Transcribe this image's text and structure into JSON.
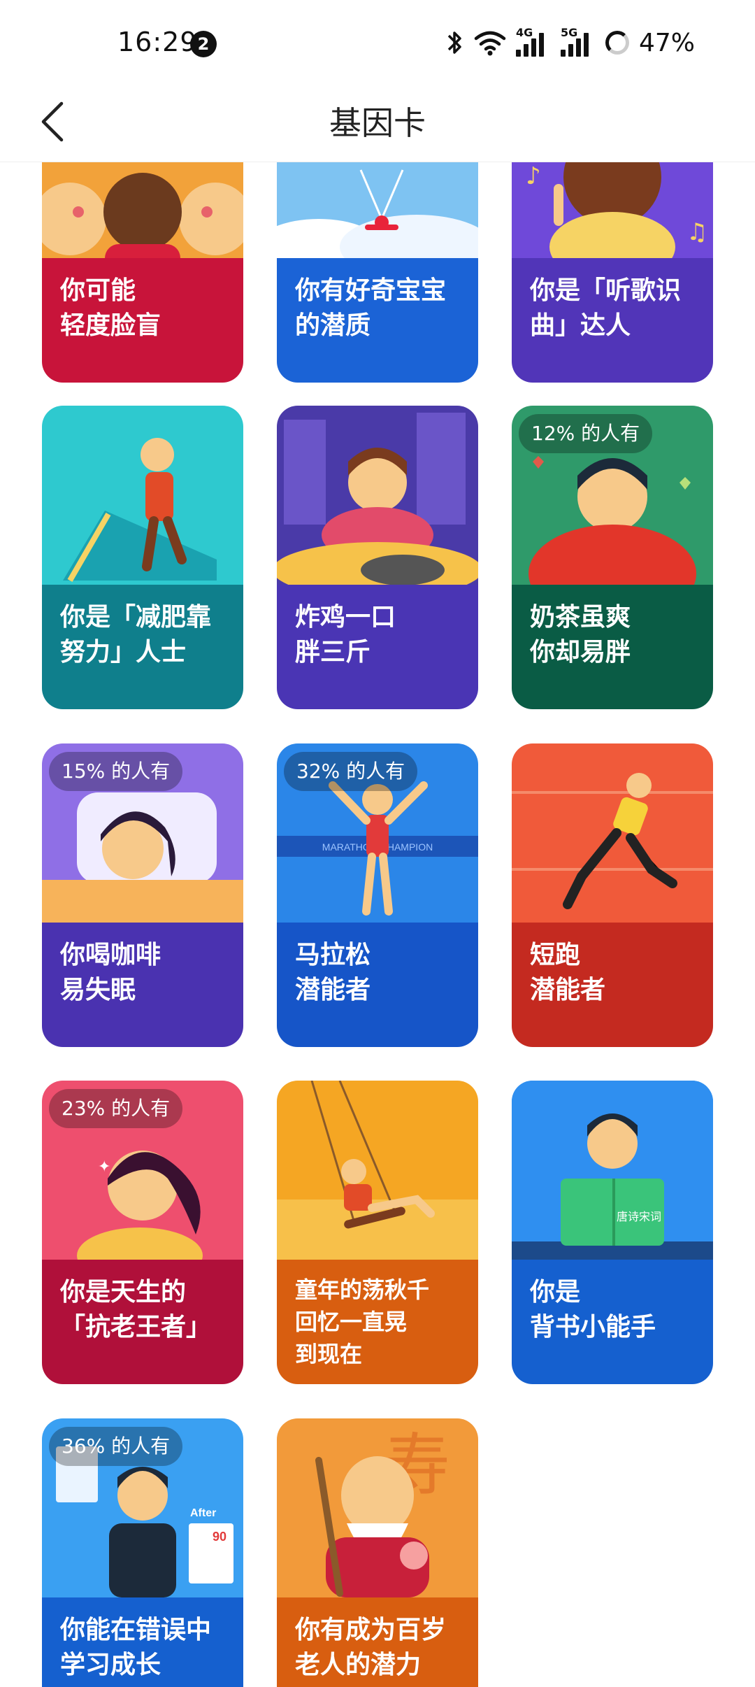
{
  "status_bar": {
    "time": "16:29",
    "notification_count": "2",
    "network_4g": "4G",
    "network_5g": "5G",
    "battery": "47%"
  },
  "header": {
    "title": "基因卡",
    "back_icon": "chevron-left-icon"
  },
  "cards": [
    {
      "id": "face-blind",
      "line1": "你可能",
      "line2": "轻度脸盲",
      "badge": "",
      "art_color": "#f2a23a",
      "cap_color": "#c8143a"
    },
    {
      "id": "curious",
      "line1": "你有好奇宝宝",
      "line2": "的潜质",
      "badge": "",
      "art_color": "#7ec3f2",
      "cap_color": "#1b63d6"
    },
    {
      "id": "song",
      "line1": "你是「听歌识",
      "line2": "曲」达人",
      "badge": "",
      "art_color": "#6f49d9",
      "cap_color": "#5135b8"
    },
    {
      "id": "diet",
      "line1": "你是「减肥靠",
      "line2": "努力」人士",
      "badge": "",
      "art_color": "#2ec9cf",
      "cap_color": "#0f7f8c"
    },
    {
      "id": "fried-chicken",
      "line1": "炸鸡一口",
      "line2": "胖三斤",
      "badge": "",
      "art_color": "#4a3aa8",
      "cap_color": "#4a35b4"
    },
    {
      "id": "milk-tea",
      "line1": "奶茶虽爽",
      "line2": "你却易胖",
      "badge": "12% 的人有",
      "art_color": "#2f9a6a",
      "cap_color": "#0a5c45"
    },
    {
      "id": "coffee",
      "line1": "你喝咖啡",
      "line2": "易失眠",
      "badge": "15% 的人有",
      "art_color": "#8f6fe6",
      "cap_color": "#4a32b0"
    },
    {
      "id": "marathon",
      "line1": "马拉松",
      "line2": "潜能者",
      "badge": "32% 的人有",
      "art_color": "#2b86e8",
      "cap_color": "#1655c8"
    },
    {
      "id": "sprint",
      "line1": "短跑",
      "line2": "潜能者",
      "badge": "",
      "art_color": "#f05a3a",
      "cap_color": "#c42a20"
    },
    {
      "id": "anti-aging",
      "line1": "你是天生的",
      "line2": "「抗老王者」",
      "badge": "23% 的人有",
      "art_color": "#ee4f6e",
      "cap_color": "#b0103a"
    },
    {
      "id": "swing",
      "line1": "童年的荡秋千",
      "line2": "回忆一直晃",
      "line3": "到现在",
      "badge": "",
      "art_color": "#f5a623",
      "cap_color": "#d85e10"
    },
    {
      "id": "recite",
      "line1": "你是",
      "line2": "背书小能手",
      "badge": "",
      "art_color": "#2f8ff0",
      "cap_color": "#1560cf"
    },
    {
      "id": "learn-mistakes",
      "line1": "你能在错误中",
      "line2": "学习成长",
      "badge": "36% 的人有",
      "art_color": "#3aa0f2",
      "cap_color": "#1560cf"
    },
    {
      "id": "centenarian",
      "line1": "你有成为百岁",
      "line2": "老人的潜力",
      "badge": "",
      "art_color": "#f29a3a",
      "cap_color": "#d85e10"
    }
  ],
  "art_text": {
    "marathon_banner": "MARATHON CHAMPION",
    "after_label": "After",
    "after_score": "90",
    "longevity_glyph": "寿",
    "book_title": "唐诗宋词"
  }
}
